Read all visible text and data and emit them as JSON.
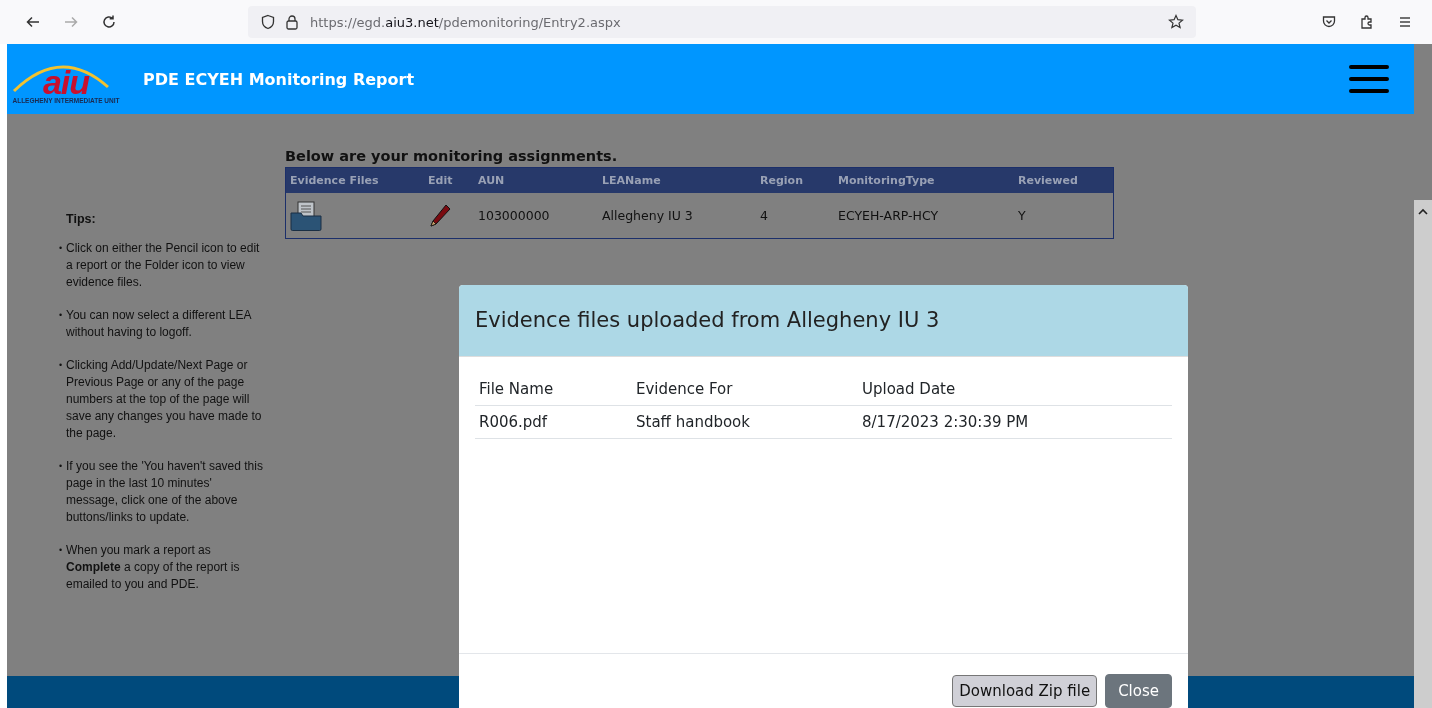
{
  "browser": {
    "url": {
      "prefix": "https://egd.",
      "domain": "aiu3.net",
      "path": "/pdemonitoring/Entry2.aspx"
    },
    "forward_disabled": true
  },
  "header": {
    "logo": {
      "mark": "aiu",
      "caption": "ALLEGHENY INTERMEDIATE UNIT"
    },
    "title": "PDE ECYEH Monitoring Report"
  },
  "tips": {
    "heading": "Tips:",
    "items": [
      {
        "bullet": "•",
        "text": "Click on either the Pencil icon to edit a report or the Folder icon to view evidence files."
      },
      {
        "bullet": "•",
        "text": "You can now select a different LEA without having to logoff."
      },
      {
        "bullet": "•",
        "text": "Clicking Add/Update/Next Page or Previous Page or any of the page numbers at the top of the page will save any changes you have made to the page."
      },
      {
        "bullet": "•",
        "text": "If you see the 'You haven't saved this page in the last 10 minutes' message, click one of the above buttons/links to update."
      },
      {
        "bullet": "•",
        "text": "When you mark a report as **Complete** a copy of the report is emailed to you and PDE."
      }
    ]
  },
  "assignments": {
    "title": "Below are your monitoring assignments.",
    "columns": [
      "Evidence Files",
      "Edit",
      "AUN",
      "LEAName",
      "Region",
      "MonitoringType",
      "Reviewed"
    ],
    "rows": [
      {
        "aun": "103000000",
        "lea_name": "Allegheny IU 3",
        "region": "4",
        "monitoring_type": "ECYEH-ARP-HCY",
        "reviewed": "Y"
      }
    ]
  },
  "modal": {
    "title": "Evidence files uploaded from Allegheny IU 3",
    "columns": [
      "File Name",
      "Evidence For",
      "Upload Date"
    ],
    "rows": [
      [
        "R006.pdf",
        "Staff handbook",
        "8/17/2023 2:30:39 PM"
      ]
    ],
    "buttons": [
      {
        "label": "Download Zip file",
        "kind": "secondary"
      },
      {
        "label": "Close",
        "kind": "dark"
      }
    ]
  }
}
